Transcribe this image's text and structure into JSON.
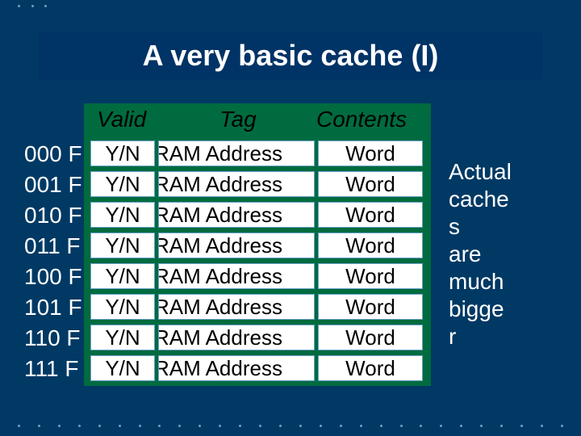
{
  "title": "A very basic cache (I)",
  "headers": {
    "valid": "Valid",
    "tag": "Tag",
    "contents": "Contents"
  },
  "rows": [
    {
      "label": "000",
      "valid": "Y/N",
      "tag": "RAM Address",
      "contents": "Word"
    },
    {
      "label": "001",
      "valid": "Y/N",
      "tag": "RAM Address",
      "contents": "Word"
    },
    {
      "label": "010",
      "valid": "Y/N",
      "tag": "RAM Address",
      "contents": "Word"
    },
    {
      "label": "011",
      "valid": "Y/N",
      "tag": "RAM Address",
      "contents": "Word"
    },
    {
      "label": "100",
      "valid": "Y/N",
      "tag": "RAM Address",
      "contents": "Word"
    },
    {
      "label": "101",
      "valid": "Y/N",
      "tag": "RAM Address",
      "contents": "Word"
    },
    {
      "label": "110",
      "valid": "Y/N",
      "tag": "RAM Address",
      "contents": "Word"
    },
    {
      "label": "111",
      "valid": "Y/N",
      "tag": "RAM Address",
      "contents": "Word"
    }
  ],
  "side_note_lines": [
    "Actual",
    "cache",
    "s",
    "are",
    "much",
    "bigge",
    "r"
  ],
  "left_col_suffix": "F"
}
